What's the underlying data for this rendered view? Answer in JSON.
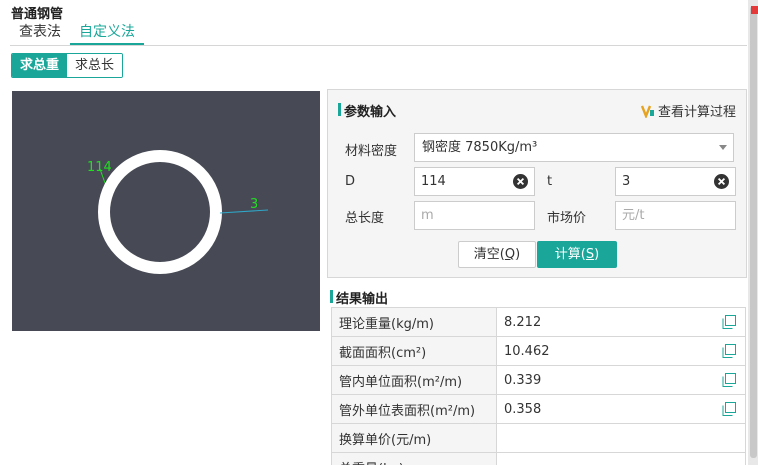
{
  "app": {
    "title": "普通钢管"
  },
  "tabs": [
    {
      "label": "查表法"
    },
    {
      "label": "自定义法"
    }
  ],
  "modes": [
    {
      "label": "求总重"
    },
    {
      "label": "求总长"
    }
  ],
  "diagram": {
    "outer_label": "114",
    "thickness_label": "3"
  },
  "params": {
    "title": "参数输入",
    "calc_process_link": "查看计算过程",
    "density_label": "材料密度",
    "density_value": "钢密度 7850Kg/m³",
    "d_label": "D",
    "d_value": "114",
    "t_label": "t",
    "t_value": "3",
    "length_label": "总长度",
    "length_placeholder": "m",
    "price_label": "市场价",
    "price_placeholder": "元/t",
    "clear_text": "清空(",
    "clear_key": "Q",
    "calc_text": "计算(",
    "calc_key": "S",
    "close_paren": ")"
  },
  "results": {
    "title": "结果输出",
    "rows": [
      {
        "label": "理论重量(kg/m)",
        "value": "8.212"
      },
      {
        "label": "截面面积(cm²)",
        "value": "10.462"
      },
      {
        "label": "管内单位面积(m²/m)",
        "value": "0.339"
      },
      {
        "label": "管外单位表面积(m²/m)",
        "value": "0.358"
      },
      {
        "label": "换算单价(元/m)",
        "value": ""
      },
      {
        "label": "总重量(kg)",
        "value": ""
      }
    ]
  },
  "colors": {
    "accent": "#1aa79a",
    "diagram_bg": "#474a55",
    "dimension_green": "#22dd22"
  }
}
